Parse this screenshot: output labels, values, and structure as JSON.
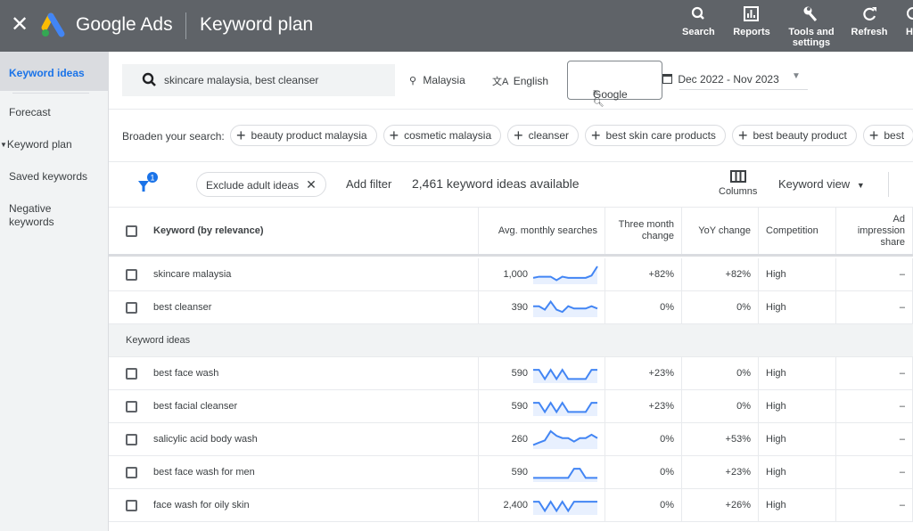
{
  "topbar": {
    "brand": "Google Ads",
    "page_title": "Keyword plan",
    "tools": [
      {
        "label": "Search",
        "icon": "search-icon"
      },
      {
        "label": "Reports",
        "icon": "reports-icon"
      },
      {
        "label": "Tools and settings",
        "icon": "wrench-icon"
      },
      {
        "label": "Refresh",
        "icon": "refresh-icon"
      },
      {
        "label": "H",
        "icon": "help-icon"
      }
    ]
  },
  "sidebar": {
    "items": [
      {
        "label": "Keyword ideas",
        "active": true
      },
      {
        "label": "Forecast"
      },
      {
        "label": "Keyword plan",
        "expandable": true
      },
      {
        "label": "Saved keywords"
      },
      {
        "label": "Negative keywords"
      }
    ]
  },
  "search": {
    "query": "skincare malaysia, best cleanser",
    "location": "Malaysia",
    "language": "English",
    "network": "Google",
    "date_range": "Dec 2022 - Nov 2023"
  },
  "broaden": {
    "label": "Broaden your search:",
    "chips": [
      "beauty product malaysia",
      "cosmetic malaysia",
      "cleanser",
      "best skin care products",
      "best beauty product",
      "best"
    ]
  },
  "filters": {
    "badge_count": "1",
    "active_filter": "Exclude adult ideas",
    "add_filter": "Add filter",
    "ideas_count": "2,461 keyword ideas available",
    "columns_label": "Columns",
    "view_label": "Keyword view"
  },
  "table": {
    "headers": [
      "Keyword (by relevance)",
      "Avg. monthly searches",
      "Three month change",
      "YoY change",
      "Competition",
      "Ad impression share"
    ],
    "group_label": "Keyword ideas",
    "provided": [
      {
        "keyword": "skincare malaysia",
        "avg": "1,000",
        "three": "+82%",
        "yoy": "+82%",
        "comp": "High",
        "share": "–",
        "trend": [
          4,
          5,
          5,
          5,
          2,
          5,
          4,
          4,
          4,
          4,
          6,
          14
        ]
      },
      {
        "keyword": "best cleanser",
        "avg": "390",
        "three": "0%",
        "yoy": "0%",
        "comp": "High",
        "share": "–",
        "trend": [
          8,
          8,
          5,
          12,
          5,
          3,
          8,
          6,
          6,
          6,
          8,
          6
        ]
      }
    ],
    "ideas": [
      {
        "keyword": "best face wash",
        "avg": "590",
        "three": "+23%",
        "yoy": "0%",
        "comp": "High",
        "share": "–",
        "trend": [
          10,
          10,
          2,
          10,
          2,
          10,
          2,
          2,
          2,
          2,
          10,
          10
        ]
      },
      {
        "keyword": "best facial cleanser",
        "avg": "590",
        "three": "+23%",
        "yoy": "0%",
        "comp": "High",
        "share": "–",
        "trend": [
          10,
          10,
          2,
          10,
          2,
          10,
          2,
          2,
          2,
          2,
          10,
          10
        ]
      },
      {
        "keyword": "salicylic acid body wash",
        "avg": "260",
        "three": "0%",
        "yoy": "+53%",
        "comp": "High",
        "share": "–",
        "trend": [
          2,
          4,
          6,
          14,
          10,
          8,
          8,
          5,
          8,
          8,
          11,
          8
        ]
      },
      {
        "keyword": "best face wash for men",
        "avg": "590",
        "three": "0%",
        "yoy": "+23%",
        "comp": "High",
        "share": "–",
        "trend": [
          2,
          2,
          2,
          2,
          2,
          2,
          2,
          10,
          10,
          2,
          2,
          2
        ]
      },
      {
        "keyword": "face wash for oily skin",
        "avg": "2,400",
        "three": "0%",
        "yoy": "+26%",
        "comp": "High",
        "share": "–",
        "trend": [
          10,
          10,
          2,
          10,
          2,
          10,
          2,
          10,
          10,
          10,
          10,
          10
        ]
      }
    ]
  },
  "colors": {
    "accent": "#1a73e8",
    "topbar": "#5f6368",
    "spark_fill": "#e8f0fe"
  }
}
